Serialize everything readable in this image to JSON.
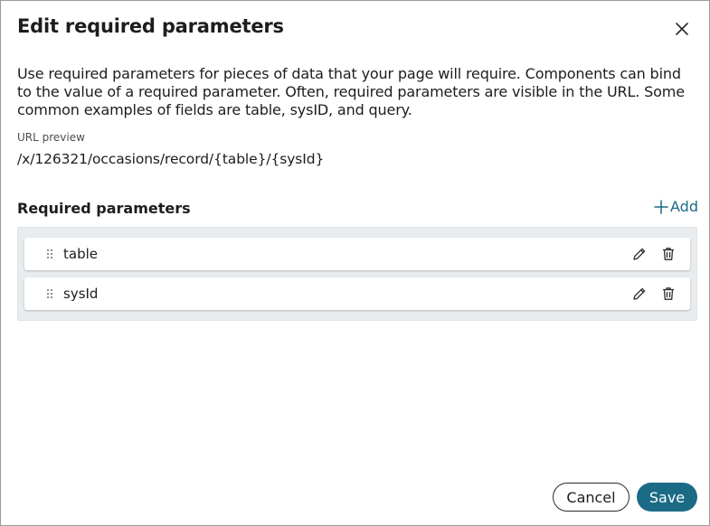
{
  "dialog": {
    "title": "Edit required parameters",
    "close_icon": "close-icon",
    "description": "Use required parameters for pieces of data that your page will require. Components can bind to the value of a required parameter. Often, required parameters are visible in the URL. Some common examples of fields are table, sysID, and query."
  },
  "url_preview": {
    "label": "URL preview",
    "value": "/x/126321/occasions/record/{table}/{sysId}"
  },
  "parameters": {
    "section_title": "Required parameters",
    "add_label": "Add",
    "add_icon": "plus-icon",
    "items": [
      {
        "name": "table",
        "drag_icon": "drag-handle-icon",
        "edit_icon": "pencil-icon",
        "delete_icon": "trash-icon"
      },
      {
        "name": "sysId",
        "drag_icon": "drag-handle-icon",
        "edit_icon": "pencil-icon",
        "delete_icon": "trash-icon"
      }
    ]
  },
  "footer": {
    "cancel_label": "Cancel",
    "save_label": "Save"
  },
  "colors": {
    "accent": "#1c6b86",
    "params_background": "#e9ecee",
    "text": "#1d1d1d"
  }
}
